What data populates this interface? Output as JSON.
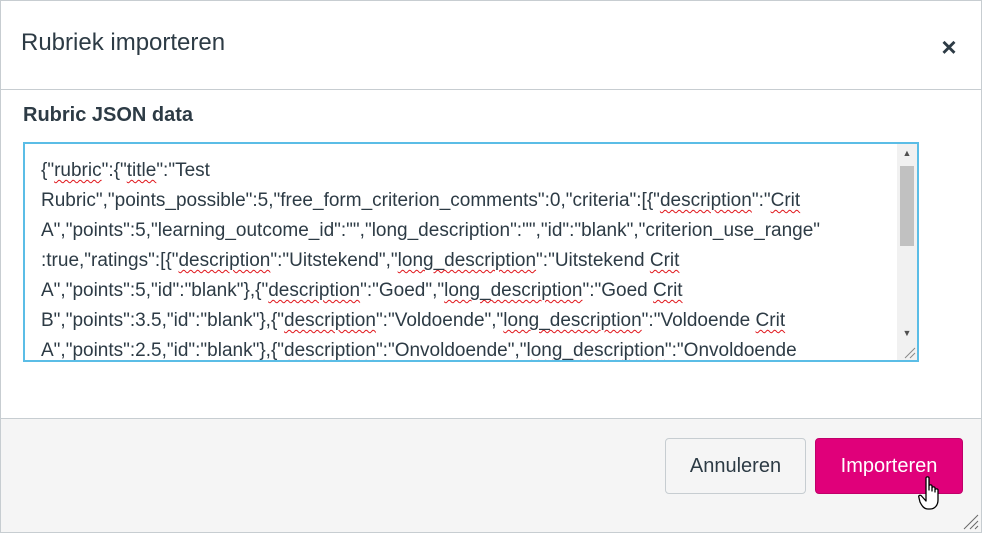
{
  "dialog": {
    "title": "Rubriek importeren",
    "close_icon": "close-icon",
    "close_symbol": "×"
  },
  "form": {
    "label": "Rubric JSON data",
    "lines": [
      [
        {
          "t": "{\""
        },
        {
          "t": "rubric",
          "s": true
        },
        {
          "t": "\":{\""
        },
        {
          "t": "title",
          "s": true
        },
        {
          "t": "\":\"Test"
        }
      ],
      [
        {
          "t": "Rubric\",\"points_possible\":5,\"free_form_criterion_comments\":0,\"criteria\":[{\""
        },
        {
          "t": "description",
          "s": true
        },
        {
          "t": "\":\""
        },
        {
          "t": "Crit",
          "s": true
        }
      ],
      [
        {
          "t": "A\",\"points\":5,\"learning_outcome_id\":\"\",\"long_description\":\"\",\"id\":\"blank\",\"criterion_use_range\""
        }
      ],
      [
        {
          "t": ":true,\"ratings\":[{\""
        },
        {
          "t": "description",
          "s": true
        },
        {
          "t": "\":\"Uitstekend\",\""
        },
        {
          "t": "long_description",
          "s": true
        },
        {
          "t": "\":\"Uitstekend "
        },
        {
          "t": "Crit",
          "s": true
        }
      ],
      [
        {
          "t": "A\",\"points\":5,\"id\":\"blank\"},{\""
        },
        {
          "t": "description",
          "s": true
        },
        {
          "t": "\":\"Goed\",\""
        },
        {
          "t": "long_description",
          "s": true
        },
        {
          "t": "\":\"Goed "
        },
        {
          "t": "Crit",
          "s": true
        }
      ],
      [
        {
          "t": "B\",\"points\":3.5,\"id\":\"blank\"},{\""
        },
        {
          "t": "description",
          "s": true
        },
        {
          "t": "\":\"Voldoende\",\""
        },
        {
          "t": "long_description",
          "s": true
        },
        {
          "t": "\":\"Voldoende "
        },
        {
          "t": "Crit",
          "s": true
        }
      ],
      [
        {
          "t": "A\",\"points\":2.5,\"id\":\"blank\"},{\""
        },
        {
          "t": "description",
          "s": true
        },
        {
          "t": "\":\"Onvoldoende\",\""
        },
        {
          "t": "long_description",
          "s": true
        },
        {
          "t": "\":\"Onvoldoende"
        }
      ]
    ]
  },
  "footer": {
    "cancel_label": "Annuleren",
    "import_label": "Importeren"
  },
  "colors": {
    "accent": "#e0007a",
    "focus_border": "#5bbde6",
    "spellcheck": "#e0151a"
  }
}
